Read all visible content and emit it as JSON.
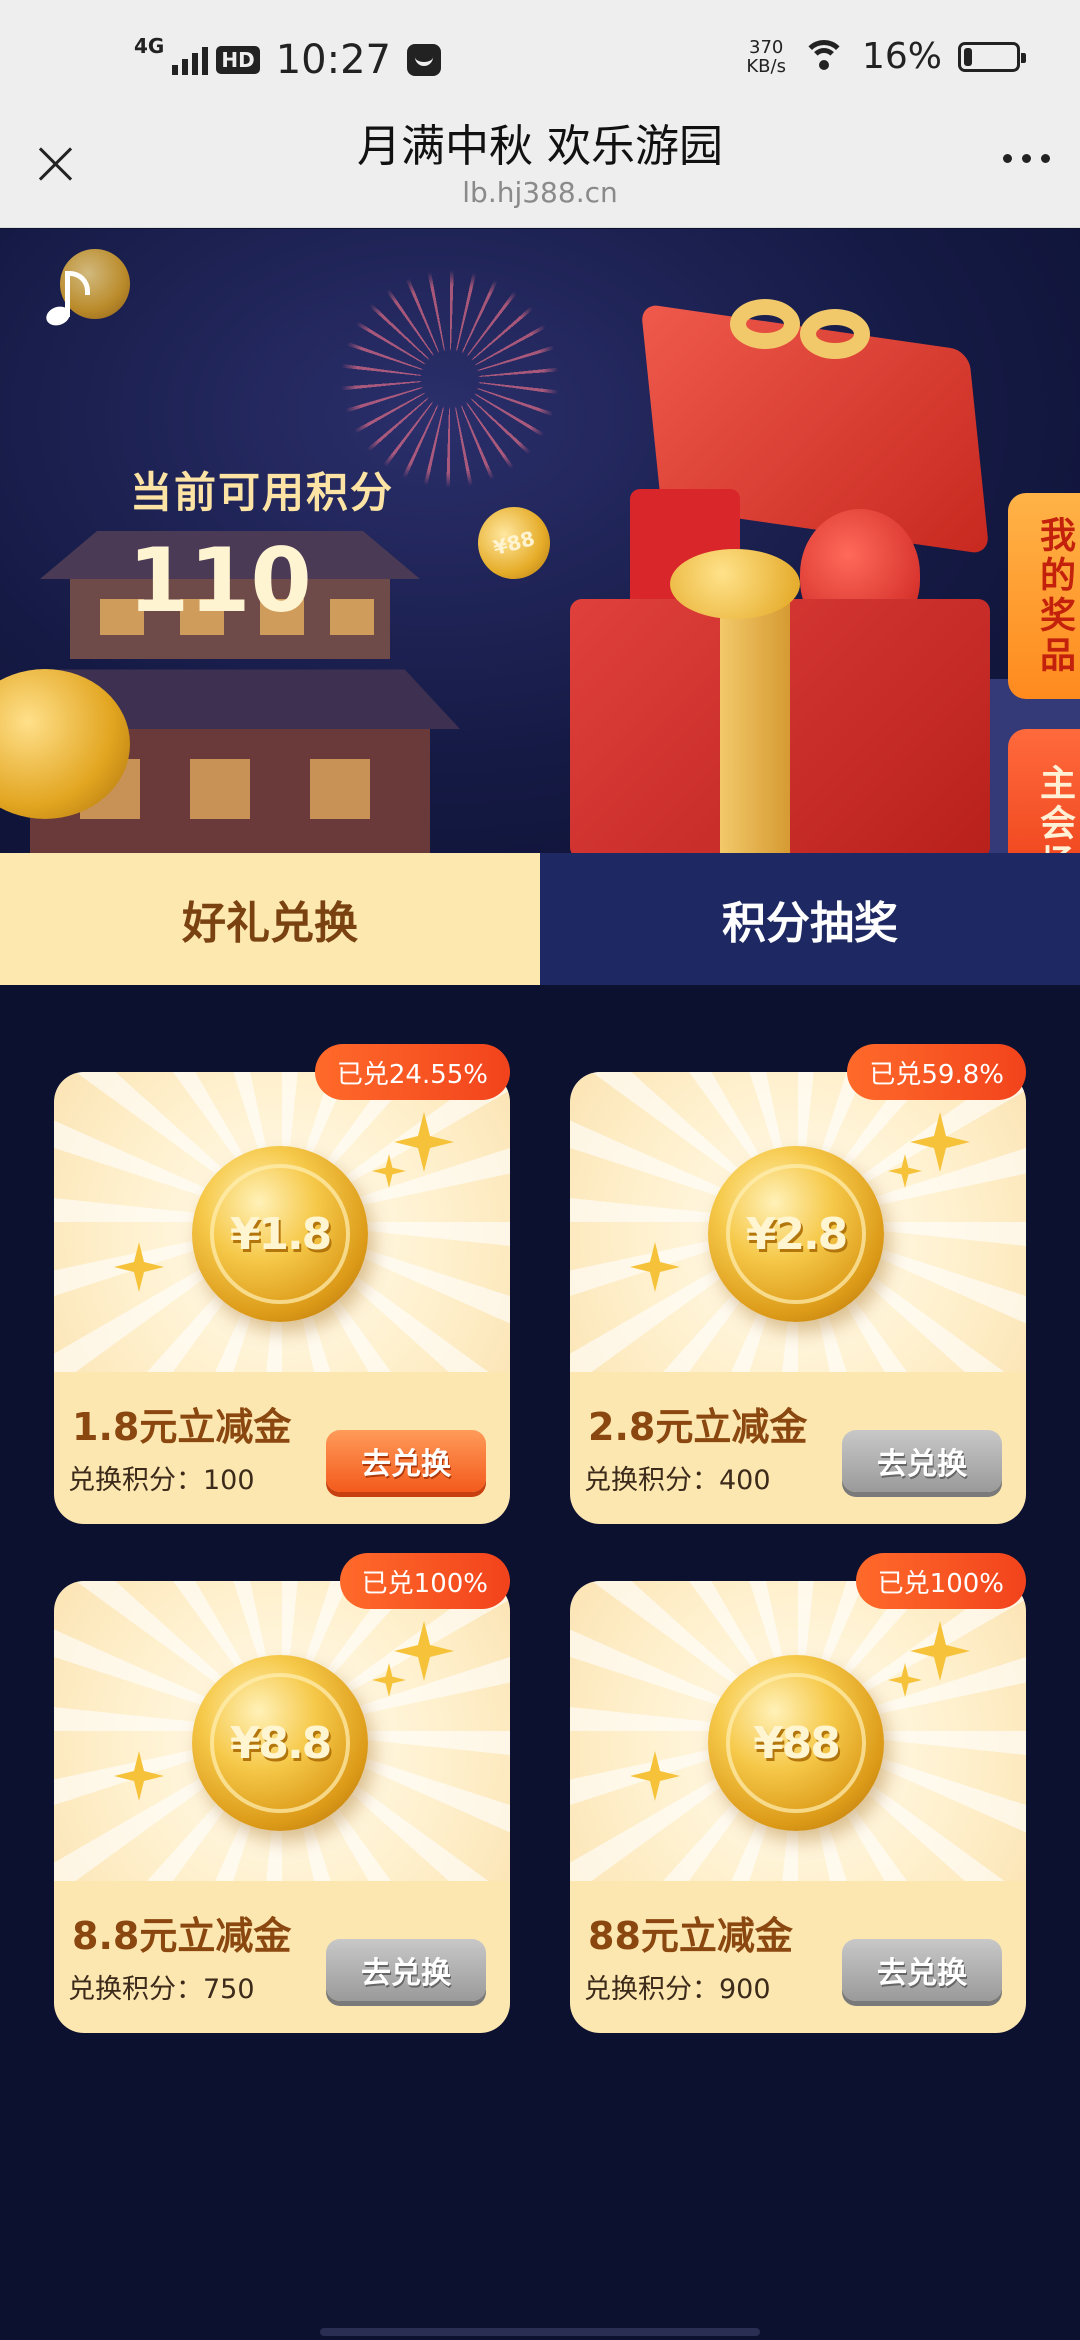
{
  "status_bar": {
    "network": "4G",
    "hd": "HD",
    "time": "10:27",
    "speed_value": "370",
    "speed_unit": "KB/s",
    "battery": "16%",
    "battery_level": 0.16
  },
  "header": {
    "title": "月满中秋 欢乐游园",
    "url": "lb.hj388.cn"
  },
  "banner": {
    "points_label": "当前可用积分",
    "points_value": "110",
    "coin_label": "¥88"
  },
  "side_tabs": [
    "我的奖品",
    "主会场"
  ],
  "tabs": [
    {
      "label": "好礼兑换",
      "active": true
    },
    {
      "label": "积分抽奖",
      "active": false
    }
  ],
  "cards": [
    {
      "coin": "¥1.8",
      "name": "1.8元立减金",
      "points": "兑换积分：100",
      "badge": "已兑24.55%",
      "button": "去兑换",
      "button_state": "enabled"
    },
    {
      "coin": "¥2.8",
      "name": "2.8元立减金",
      "points": "兑换积分：400",
      "badge": "已兑59.8%",
      "button": "去兑换",
      "button_state": "disabled"
    },
    {
      "coin": "¥8.8",
      "name": "8.8元立减金",
      "points": "兑换积分：750",
      "badge": "已兑100%",
      "button": "去兑换",
      "button_state": "disabled"
    },
    {
      "coin": "¥88",
      "name": "88元立减金",
      "points": "兑换积分：900",
      "badge": "已兑100%",
      "button": "去兑换",
      "button_state": "disabled"
    }
  ],
  "colors": {
    "page_bg": "#0d1130",
    "tab_active_bg": "#fde8b0",
    "tab_inactive_bg": "#1e2863",
    "badge": "#f2431c",
    "button_enabled": "#f35a1c",
    "button_disabled": "#9a9a9a"
  }
}
